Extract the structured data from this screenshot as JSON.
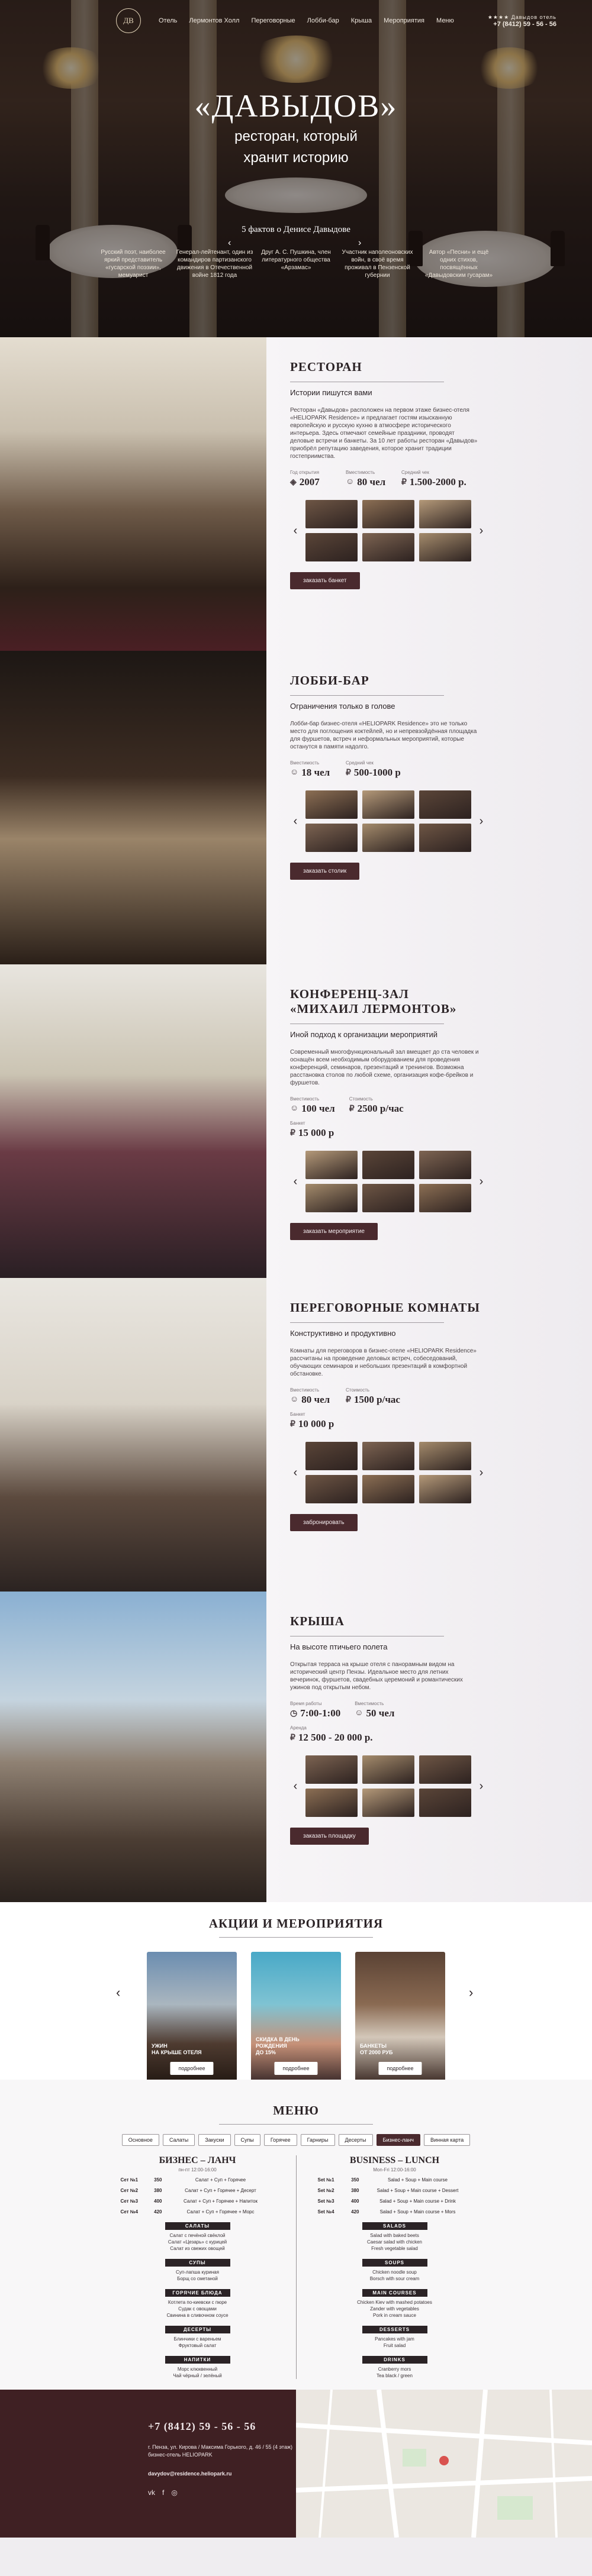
{
  "colors": {
    "accent": "#4a2a2e",
    "footer": "#3f2023"
  },
  "nav": {
    "logo": "ДВ",
    "items": [
      "Отель",
      "Лермонтов Холл",
      "Переговорные",
      "Лобби-бар",
      "Крыша",
      "Мероприятия",
      "Меню"
    ],
    "stars": "★★★★ Давыдов отель",
    "phone": "+7 (8412) 59 - 56 - 56"
  },
  "hero": {
    "title": "«ДАВЫДОВ»",
    "subtitle_1": "ресторан, который",
    "subtitle_2": "хранит историю",
    "facts_title": "5 фактов о Денисе Давыдове",
    "facts": [
      "Русский поэт, наиболее яркий представитель «гусарской поэзии», мемуарист",
      "Генерал-лейтенант, один из командиров партизанского движения в Отечественной войне 1812 года",
      "Друг А. С. Пушкина, член литературного общества «Арзамас»",
      "Участник наполеоновских войн, в своё время проживал в Пензенской губернии",
      "Автор «Песни» и ещё одних стихов, посвящённых «Давыдовским гусарам»"
    ]
  },
  "venues": [
    {
      "title": "РЕСТОРАН",
      "sub": "Истории пишутся вами",
      "desc": "Ресторан «Давыдов» расположен на первом этаже бизнес-отеля «HELIOPARK Residence» и предлагает гостям изысканную европейскую и русскую кухню в атмосфере исторического интерьера. Здесь отмечают семейные праздники, проводят деловые встречи и банкеты. За 10 лет работы ресторан «Давыдов» приобрёл репутацию заведения, которое хранит традиции гостеприимства.",
      "stats": [
        {
          "lbl": "Год открытия",
          "val": "2007",
          "ic": "◈"
        },
        {
          "lbl": "Вместимость",
          "val": "80 чел",
          "ic": "☺"
        },
        {
          "lbl": "Средний чек",
          "val": "1.500-2000 р.",
          "ic": "₽"
        }
      ],
      "stats2": [],
      "button": "заказать банкет"
    },
    {
      "title": "ЛОББИ-БАР",
      "sub": "Ограничения только в голове",
      "desc": "Лобби-бар бизнес-отеля «HELIOPARK Residence» это не только место для поглощения коктейлей, но и непревзойдённая площадка для фуршетов, встреч и неформальных мероприятий, которые останутся в памяти надолго.",
      "stats": [
        {
          "lbl": "Вместимость",
          "val": "18 чел",
          "ic": "☺"
        },
        {
          "lbl": "Средний чек",
          "val": "500-1000 р",
          "ic": "₽"
        }
      ],
      "stats2": [],
      "button": "заказать столик"
    },
    {
      "title": "КОНФЕРЕНЦ-ЗАЛ\n«МИХАИЛ ЛЕРМОНТОВ»",
      "sub": "Иной подход к организации мероприятий",
      "desc": "Современный многофункциональный зал вмещает до ста человек и оснащён всем необходимым оборудованием для проведения конференций, семинаров, презентаций и тренингов. Возможна расстановка столов по любой схеме, организация кофе-брейков и фуршетов.",
      "stats": [
        {
          "lbl": "Вместимость",
          "val": "100 чел",
          "ic": "☺"
        },
        {
          "lbl": "Стоимость",
          "val": "2500 р/час",
          "ic": "₽"
        }
      ],
      "stats2": [
        {
          "lbl": "Банкет",
          "val": "15 000 р",
          "ic": "₽"
        }
      ],
      "button": "заказать мероприятие"
    },
    {
      "title": "ПЕРЕГОВОРНЫЕ КОМНАТЫ",
      "sub": "Конструктивно и продуктивно",
      "desc": "Комнаты для переговоров в бизнес-отеле «HELIOPARK Residence» рассчитаны на проведение деловых встреч, собеседований, обучающих семинаров и небольших презентаций в комфортной обстановке.",
      "stats": [
        {
          "lbl": "Вместимость",
          "val": "80 чел",
          "ic": "☺"
        },
        {
          "lbl": "Стоимость",
          "val": "1500 р/час",
          "ic": "₽"
        }
      ],
      "stats2": [
        {
          "lbl": "Банкет",
          "val": "10 000 р",
          "ic": "₽"
        }
      ],
      "button": "забронировать"
    },
    {
      "title": "КРЫША",
      "sub": "На высоте птичьего полета",
      "desc": "Открытая терраса на крыше отеля с панорамным видом на исторический центр Пензы. Идеальное место для летних вечеринок, фуршетов, свадебных церемоний и романтических ужинов под открытым небом.",
      "stats": [
        {
          "lbl": "Время работы",
          "val": "7:00-1:00",
          "ic": "◷"
        },
        {
          "lbl": "Вместимость",
          "val": "50 чел",
          "ic": "☺"
        }
      ],
      "stats2": [
        {
          "lbl": "Аренда",
          "val": "12 500 - 20 000 р.",
          "ic": "₽"
        }
      ],
      "button": "заказать площадку"
    }
  ],
  "promos": {
    "title": "АКЦИИ И МЕРОПРИЯТИЯ",
    "cards": [
      {
        "caption": "УЖИН\nНА КРЫШЕ ОТЕЛЯ",
        "button": "подробнее"
      },
      {
        "caption": "СКИДКА В ДЕНЬ\nРОЖДЕНИЯ\nДО 15%",
        "button": "подробнее"
      },
      {
        "caption": "БАНКЕТЫ\nОТ 2000 РУБ",
        "button": "подробнее"
      }
    ]
  },
  "menu": {
    "title": "МЕНЮ",
    "tabs": [
      "Основное",
      "Салаты",
      "Закуски",
      "Супы",
      "Горячее",
      "Гарниры",
      "Десерты",
      "Бизнес-ланч",
      "Винная карта"
    ],
    "active_tab": "Бизнес-ланч",
    "ru": {
      "title": "БИЗНЕС – ЛАНЧ",
      "note": "пн-пт 12:00-16:00",
      "rows": [
        {
          "k": "Сет №1",
          "p": "350",
          "d": "Салат + Суп + Горячее"
        },
        {
          "k": "Сет №2",
          "p": "380",
          "d": "Салат + Суп + Горячее + Десерт"
        },
        {
          "k": "Сет №3",
          "p": "400",
          "d": "Салат + Суп + Горячее + Напиток"
        },
        {
          "k": "Сет №4",
          "p": "420",
          "d": "Салат + Суп + Горячее + Морс"
        }
      ],
      "sections": [
        {
          "h": "САЛАТЫ",
          "lines": [
            "Салат с печёной свёклой",
            "Салат «Цезарь» с курицей",
            "Салат из свежих овощей"
          ]
        },
        {
          "h": "СУПЫ",
          "lines": [
            "Суп-лапша куриная",
            "Борщ со сметаной"
          ]
        },
        {
          "h": "ГОРЯЧИЕ БЛЮДА",
          "lines": [
            "Котлета по-киевски с пюре",
            "Судак с овощами",
            "Свинина в сливочном соусе"
          ]
        },
        {
          "h": "ДЕСЕРТЫ",
          "lines": [
            "Блинчики с вареньем",
            "Фруктовый салат"
          ]
        },
        {
          "h": "НАПИТКИ",
          "lines": [
            "Морс клюквенный",
            "Чай чёрный / зелёный"
          ]
        }
      ]
    },
    "en": {
      "title": "BUSINESS – LUNCH",
      "note": "Mon-Fri 12:00-16:00",
      "rows": [
        {
          "k": "Set №1",
          "p": "350",
          "d": "Salad + Soup + Main course"
        },
        {
          "k": "Set №2",
          "p": "380",
          "d": "Salad + Soup + Main course + Dessert"
        },
        {
          "k": "Set №3",
          "p": "400",
          "d": "Salad + Soup + Main course + Drink"
        },
        {
          "k": "Set №4",
          "p": "420",
          "d": "Salad + Soup + Main course + Mors"
        }
      ],
      "sections": [
        {
          "h": "SALADS",
          "lines": [
            "Salad with baked beets",
            "Caesar salad with chicken",
            "Fresh vegetable salad"
          ]
        },
        {
          "h": "SOUPS",
          "lines": [
            "Chicken noodle soup",
            "Borsch with sour cream"
          ]
        },
        {
          "h": "MAIN COURSES",
          "lines": [
            "Chicken Kiev with mashed potatoes",
            "Zander with vegetables",
            "Pork in cream sauce"
          ]
        },
        {
          "h": "DESSERTS",
          "lines": [
            "Pancakes with jam",
            "Fruit salad"
          ]
        },
        {
          "h": "DRINKS",
          "lines": [
            "Cranberry mors",
            "Tea black / green"
          ]
        }
      ]
    }
  },
  "footer": {
    "phone": "+7 (8412) 59 - 56 - 56",
    "address": "г. Пенза, ул. Кирова / Максима Горького, д. 46 / 55 (4 этаж) бизнес-отель HELIOPARK",
    "email": "davydov@residence.heliopark.ru",
    "social": [
      "vk-icon",
      "facebook-icon",
      "instagram-icon"
    ]
  }
}
